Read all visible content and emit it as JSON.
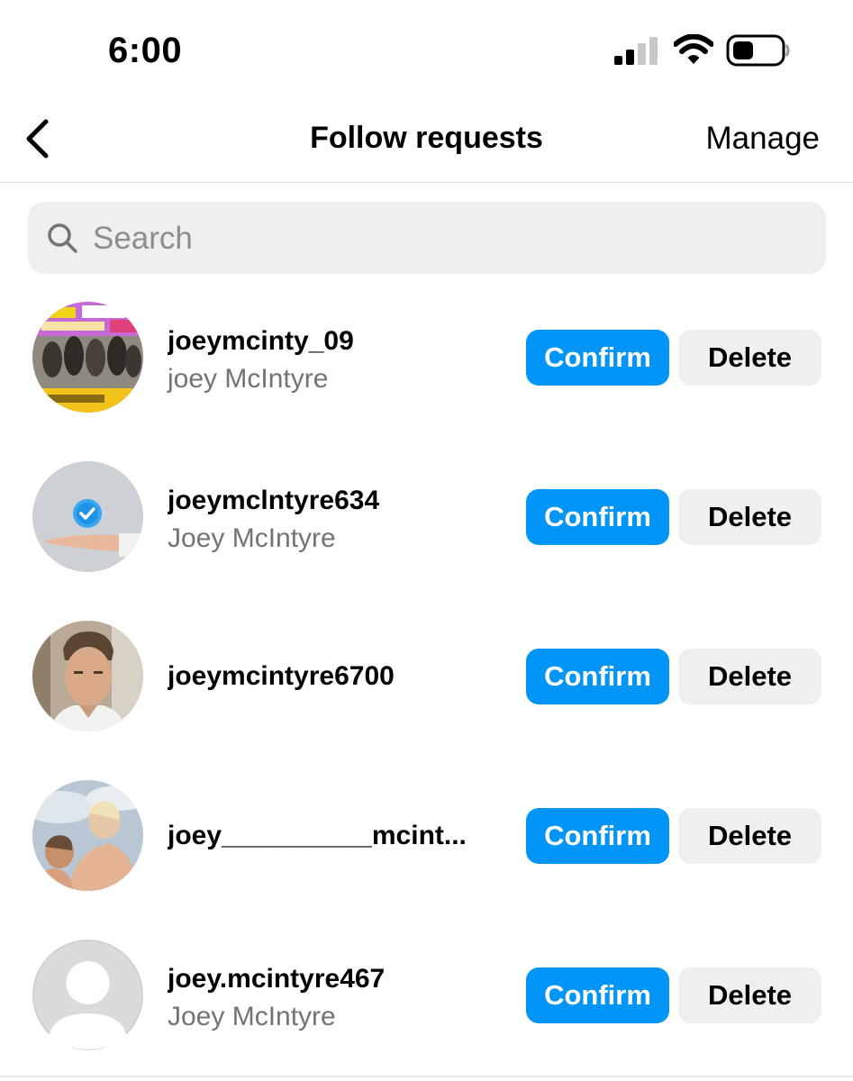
{
  "status_bar": {
    "time": "6:00",
    "icons": [
      "cellular-signal-icon",
      "wifi-icon",
      "battery-icon"
    ]
  },
  "nav": {
    "back_icon": "chevron-left-icon",
    "title": "Follow requests",
    "manage_label": "Manage"
  },
  "search": {
    "icon": "search-icon",
    "placeholder": "Search",
    "value": ""
  },
  "requests": [
    {
      "username": "joeymcinty_09",
      "full_name": "joey McIntyre",
      "avatar": "concert-poster-avatar",
      "confirm_label": "Confirm",
      "delete_label": "Delete"
    },
    {
      "username": "joeymclntyre634",
      "full_name": "Joey McIntyre",
      "avatar": "verified-badge-hand-avatar",
      "confirm_label": "Confirm",
      "delete_label": "Delete"
    },
    {
      "username": "joeymcintyre6700",
      "full_name": "",
      "avatar": "portrait-photo-avatar",
      "confirm_label": "Confirm",
      "delete_label": "Delete"
    },
    {
      "username": "joey__________mcint...",
      "full_name": "",
      "avatar": "selfie-photo-avatar",
      "confirm_label": "Confirm",
      "delete_label": "Delete"
    },
    {
      "username": "joey.mcintyre467",
      "full_name": "Joey McIntyre",
      "avatar": "default-profile-avatar",
      "confirm_label": "Confirm",
      "delete_label": "Delete"
    }
  ],
  "colors": {
    "confirm_blue": "#0095f6",
    "secondary_button_gray": "#efefef",
    "secondary_text": "#737373",
    "search_background": "#efefef"
  }
}
